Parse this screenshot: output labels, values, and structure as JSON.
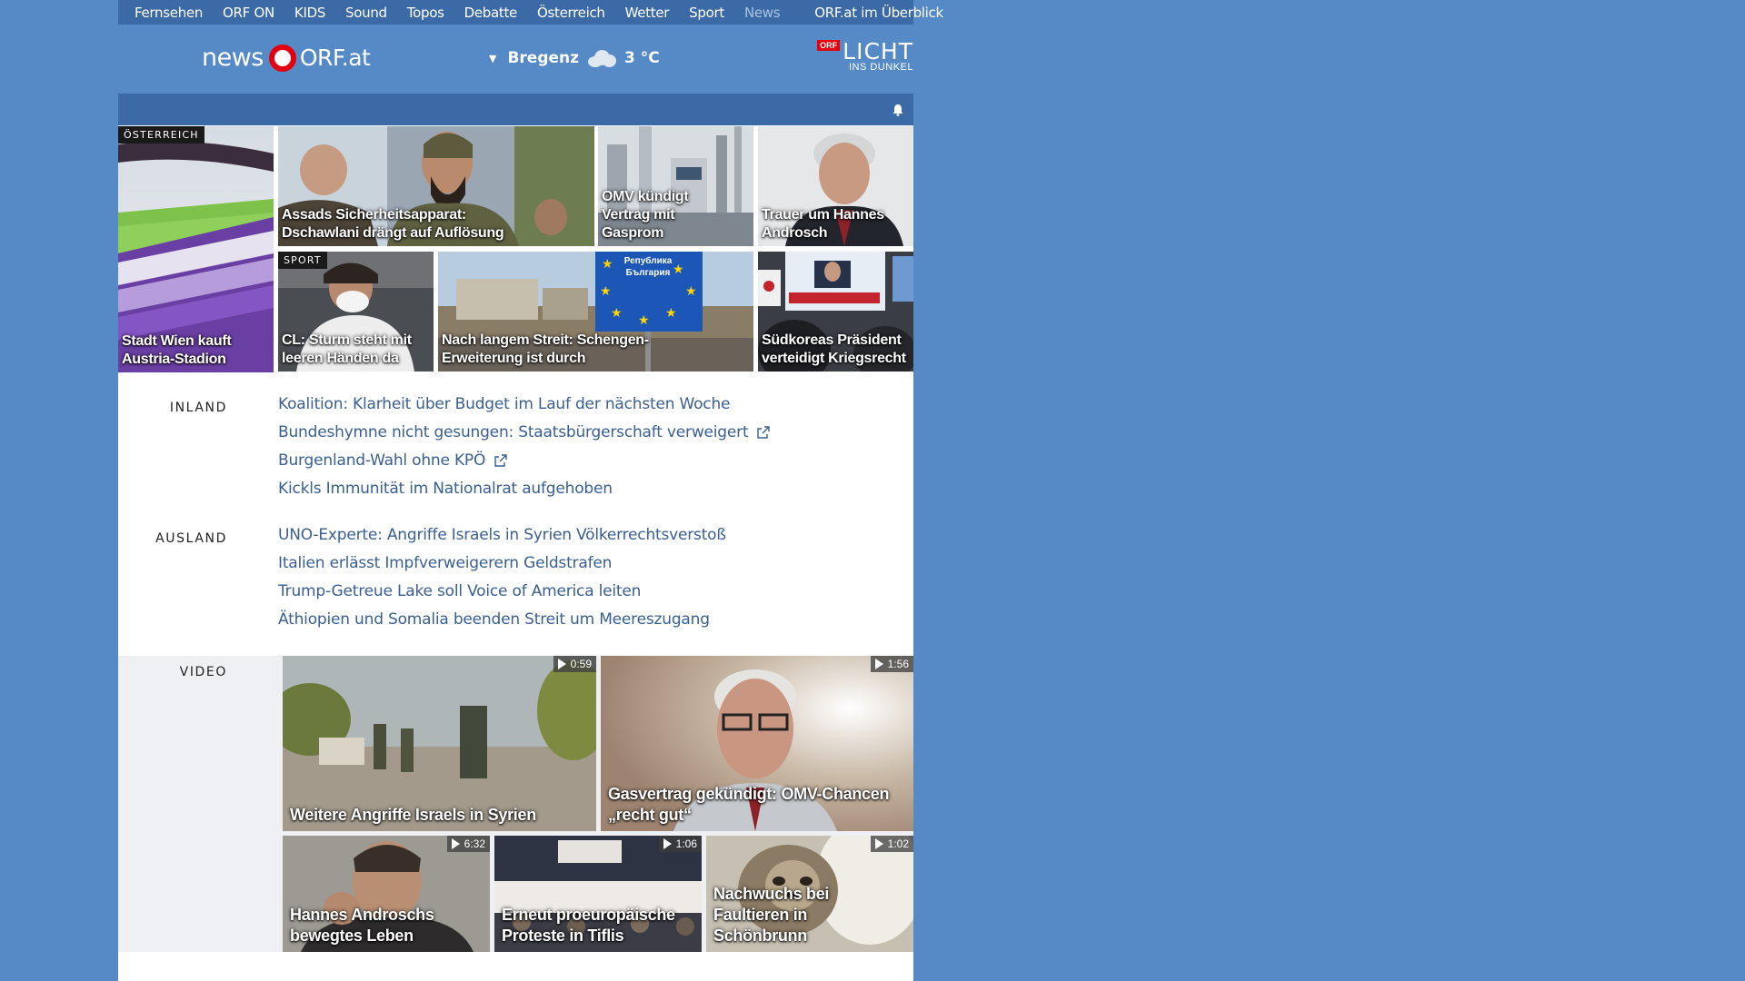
{
  "topnav": [
    {
      "label": "Fernsehen"
    },
    {
      "label": "ORF ON"
    },
    {
      "label": "KIDS"
    },
    {
      "label": "Sound"
    },
    {
      "label": "Topos"
    },
    {
      "label": "Debatte"
    },
    {
      "label": "Österreich"
    },
    {
      "label": "Wetter"
    },
    {
      "label": "Sport"
    },
    {
      "label": "News"
    }
  ],
  "topnav_overview": "ORF.at im Überblick",
  "header": {
    "logo_news": "news",
    "logo_orf": "ORF.at",
    "weather_city": "Bregenz",
    "weather_temp": "3 °C",
    "licht_orf": "ORF",
    "licht_big": "LICHT",
    "licht_small": "INS DUNKEL"
  },
  "tiles": [
    {
      "tag": "ÖSTERREICH",
      "caption": "Stadt Wien kauft Austria-Stadion"
    },
    {
      "caption": "Assads Sicherheitsapparat: Dschawlani drängt auf Auflösung"
    },
    {
      "caption": "OMV kündigt Vertrag mit Gasprom"
    },
    {
      "caption": "Trauer um Hannes Androsch"
    },
    {
      "tag": "SPORT",
      "caption": "CL: Sturm steht mit leeren Händen da"
    },
    {
      "caption": "Nach langem Streit: Schengen-Erweiterung ist durch"
    },
    {
      "caption": "Südkoreas Präsident verteidigt Kriegsrecht"
    }
  ],
  "sign_text": "Република България",
  "inland": {
    "label": "INLAND",
    "items": [
      {
        "title": "Koalition: Klarheit über Budget im Lauf der nächsten Woche"
      },
      {
        "title": "Bundeshymne nicht gesungen: Staatsbürgerschaft verweigert"
      },
      {
        "title": "Burgenland-Wahl ohne KPÖ"
      },
      {
        "title": "Kickls Immunität im Nationalrat aufgehoben"
      }
    ]
  },
  "ausland": {
    "label": "AUSLAND",
    "items": [
      {
        "title": "UNO-Experte: Angriffe Israels in Syrien Völkerrechtsverstoß"
      },
      {
        "title": "Italien erlässt Impfverweigerern Geldstrafen"
      },
      {
        "title": "Trump-Getreue Lake soll Voice of America leiten"
      },
      {
        "title": "Äthiopien und Somalia beenden Streit um Meereszugang"
      }
    ]
  },
  "video": {
    "label": "VIDEO",
    "items": [
      {
        "caption": "Weitere Angriffe Israels in Syrien",
        "duration": "0:59"
      },
      {
        "caption": "Gasvertrag gekündigt: OMV-Chancen „recht gut“",
        "duration": "1:56"
      },
      {
        "caption": "Hannes Androschs bewegtes Leben",
        "duration": "6:32"
      },
      {
        "caption": "Erneut proeuropäische Proteste in Tiflis",
        "duration": "1:06"
      },
      {
        "caption": "Nachwuchs bei Faultieren in Schönbrunn",
        "duration": "1:02"
      }
    ]
  },
  "colors": {
    "page_bg": "#568ac6",
    "nav_bg": "#3c6aa6",
    "link": "#3a5f92",
    "orf_red": "#e3000f"
  }
}
